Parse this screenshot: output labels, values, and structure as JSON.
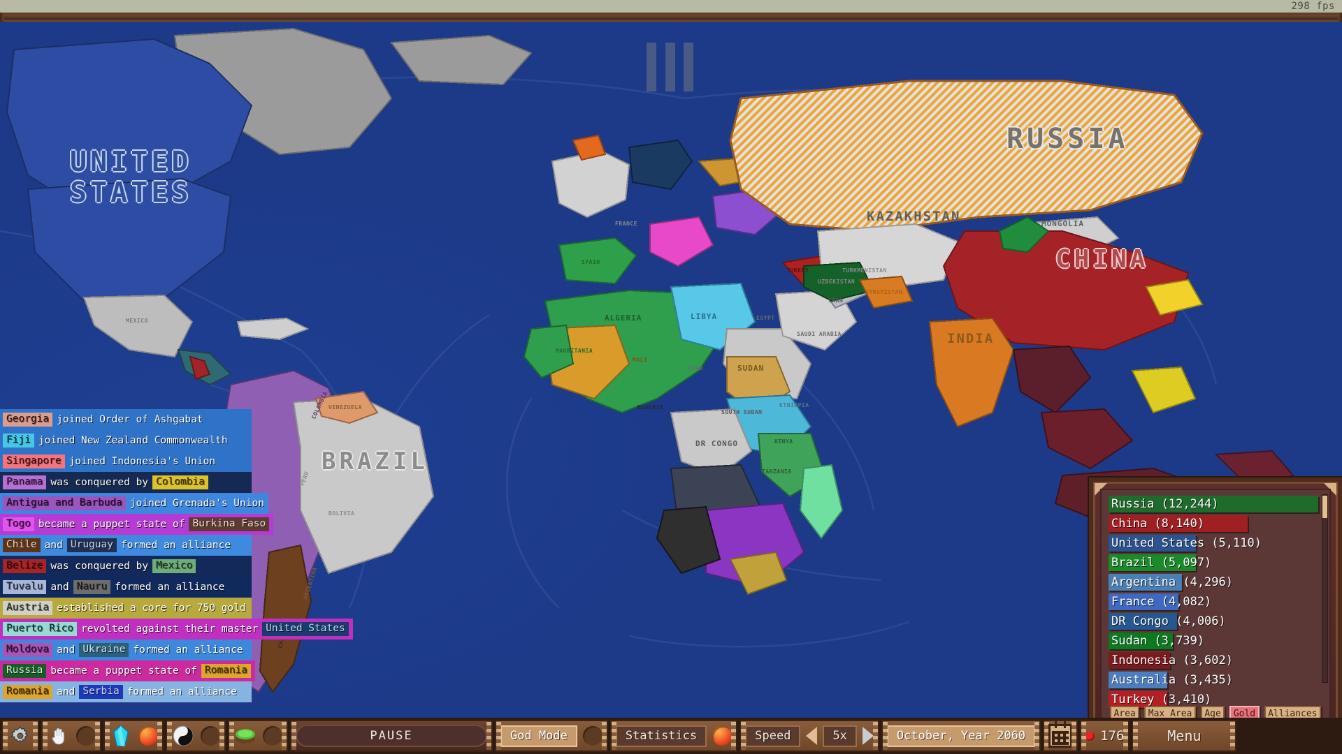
{
  "window": {
    "fps_label": "298 fps"
  },
  "map": {
    "labels": [
      {
        "text": "UNITED STATES",
        "line2": "STATES",
        "line1": "UNITED"
      },
      {
        "text": "RUSSIA"
      },
      {
        "text": "CHINA"
      },
      {
        "text": "BRAZIL"
      },
      {
        "text": "KAZAKHSTAN"
      },
      {
        "text": "MONGOLIA"
      },
      {
        "text": "INDIA"
      },
      {
        "text": "ALGERIA"
      },
      {
        "text": "LIBYA"
      },
      {
        "text": "EGYPT"
      },
      {
        "text": "SUDAN"
      },
      {
        "text": "CHAD"
      },
      {
        "text": "MALI"
      },
      {
        "text": "MAURITANIA"
      },
      {
        "text": "NIGERIA"
      },
      {
        "text": "DR CONGO"
      },
      {
        "text": "KENYA"
      },
      {
        "text": "TANZANIA"
      },
      {
        "text": "ETHIOPIA"
      },
      {
        "text": "SOUTH SUDAN"
      },
      {
        "text": "SAUDI ARABIA"
      },
      {
        "text": "IRAN"
      },
      {
        "text": "TURKEY"
      },
      {
        "text": "UZBEKISTAN"
      },
      {
        "text": "TURKMENISTAN"
      },
      {
        "text": "KYRGYZSTAN"
      },
      {
        "text": "FRANCE"
      },
      {
        "text": "SPAIN"
      },
      {
        "text": "MEXICO"
      },
      {
        "text": "COLOMBIA"
      },
      {
        "text": "VENEZUELA"
      },
      {
        "text": "PERU"
      },
      {
        "text": "BOLIVIA"
      },
      {
        "text": "ARGENTINA"
      },
      {
        "text": "CHILE"
      }
    ]
  },
  "event_log": {
    "rows": [
      {
        "bg": "#2f73c9",
        "parts": [
          {
            "text": "Georgia",
            "tag": true,
            "bg": "#dd9c8e",
            "color": "#241414"
          },
          {
            "text": "joined Order of Ashgabat",
            "tag": false
          }
        ]
      },
      {
        "bg": "#2f73c9",
        "parts": [
          {
            "text": "Fiji",
            "tag": true,
            "bg": "#45c8e8",
            "color": "#12303a"
          },
          {
            "text": "joined New Zealand Commonwealth",
            "tag": false
          }
        ]
      },
      {
        "bg": "#2f73c9",
        "parts": [
          {
            "text": "Singapore",
            "tag": true,
            "bg": "#f4757e",
            "color": "#3a0e12"
          },
          {
            "text": "joined Indonesia's Union",
            "tag": false
          }
        ]
      },
      {
        "bg": "#152a52",
        "parts": [
          {
            "text": "Panama",
            "tag": true,
            "bg": "#b86fd4",
            "color": "#2b1036"
          },
          {
            "text": "was conquered by",
            "tag": false
          },
          {
            "text": "Colombia",
            "tag": true,
            "bg": "#ddc229",
            "color": "#3a3105"
          }
        ]
      },
      {
        "bg": "#3f86de",
        "parts": [
          {
            "text": "Antigua and Barbuda",
            "tag": true,
            "bg": "#9b55bd",
            "color": "#1e0b28"
          },
          {
            "text": "joined Grenada's Union",
            "tag": false
          }
        ]
      },
      {
        "bg": "#b63ad4",
        "parts": [
          {
            "text": "Togo",
            "tag": true,
            "bg": "#e254ee",
            "color": "#340a38"
          },
          {
            "text": "became a puppet state of",
            "tag": false
          },
          {
            "text": "Burkina Faso",
            "tag": true,
            "bg": "#5d3a32",
            "color": "#f0dfd5"
          }
        ]
      },
      {
        "bg": "#3d8ade",
        "parts": [
          {
            "text": "Chile",
            "tag": true,
            "bg": "#5e3318",
            "color": "#f2e0cd"
          },
          {
            "text": "and",
            "tag": false
          },
          {
            "text": "Uruguay",
            "tag": true,
            "bg": "#1f3054",
            "color": "#ccd6e8"
          },
          {
            "text": "formed an alliance",
            "tag": false
          }
        ]
      },
      {
        "bg": "#12295a",
        "parts": [
          {
            "text": "Belize",
            "tag": true,
            "bg": "#a82426",
            "color": "#2c0607"
          },
          {
            "text": "was conquered by",
            "tag": false
          },
          {
            "text": "Mexico",
            "tag": true,
            "bg": "#6fad78",
            "color": "#16301a"
          }
        ]
      },
      {
        "bg": "#102a5e",
        "parts": [
          {
            "text": "Tuvalu",
            "tag": true,
            "bg": "#a8b6d8",
            "color": "#1c2434"
          },
          {
            "text": "and",
            "tag": false
          },
          {
            "text": "Nauru",
            "tag": true,
            "bg": "#6d6d6d",
            "color": "#18181a"
          },
          {
            "text": "formed an alliance",
            "tag": false
          }
        ]
      },
      {
        "bg": "#b8a93c",
        "parts": [
          {
            "text": "Austria",
            "tag": true,
            "bg": "#d0d0c8",
            "color": "#24241e"
          },
          {
            "text": "established a core for 750 gold",
            "tag": false
          }
        ]
      },
      {
        "bg": "#c12fc0",
        "parts": [
          {
            "text": "Puerto Rico",
            "tag": true,
            "bg": "#97d9d4",
            "color": "#10302e"
          },
          {
            "text": "revolted against their master",
            "tag": false
          },
          {
            "text": "United States",
            "tag": true,
            "bg": "#1b3a6e",
            "color": "#c8d6ec"
          }
        ]
      },
      {
        "bg": "#3c88dc",
        "parts": [
          {
            "text": "Moldova",
            "tag": true,
            "bg": "#a855b6",
            "color": "#2a0d2e"
          },
          {
            "text": "and",
            "tag": false
          },
          {
            "text": "Ukraine",
            "tag": true,
            "bg": "#2c5f7a",
            "color": "#d0e2ec"
          },
          {
            "text": "formed an alliance",
            "tag": false
          }
        ]
      },
      {
        "bg": "#cc2a9e",
        "parts": [
          {
            "text": "Russia",
            "tag": true,
            "bg": "#1a5c28",
            "color": "#d8eedd"
          },
          {
            "text": "became a puppet state of",
            "tag": false
          },
          {
            "text": "Romania",
            "tag": true,
            "bg": "#dea52c",
            "color": "#3a2706"
          }
        ]
      },
      {
        "bg": "#86b4e2",
        "parts": [
          {
            "text": "Romania",
            "tag": true,
            "bg": "#dea52c",
            "color": "#3a2706"
          },
          {
            "text": "and",
            "tag": false
          },
          {
            "text": "Serbia",
            "tag": true,
            "bg": "#1c39b8",
            "color": "#cfd8f4"
          },
          {
            "text": "formed an alliance"
          }
        ]
      }
    ]
  },
  "leaderboard": {
    "metric": "Gold",
    "max_value": 12244,
    "entries": [
      {
        "name": "Russia",
        "value": 12244,
        "display": "Russia (12,244)",
        "color": "#1f6b2b"
      },
      {
        "name": "China",
        "value": 8140,
        "display": "China (8,140)",
        "color": "#a01f22"
      },
      {
        "name": "United States",
        "value": 5110,
        "display": "United States (5,110)",
        "color": "#2b5390"
      },
      {
        "name": "Brazil",
        "value": 5097,
        "display": "Brazil (5,097)",
        "color": "#1a8a2a"
      },
      {
        "name": "Argentina",
        "value": 4296,
        "display": "Argentina (4,296)",
        "color": "#4a7fb5"
      },
      {
        "name": "France",
        "value": 4082,
        "display": "France (4,082)",
        "color": "#3f68c0"
      },
      {
        "name": "DR Congo",
        "value": 4006,
        "display": "DR Congo (4,006)",
        "color": "#26578f"
      },
      {
        "name": "Sudan",
        "value": 3739,
        "display": "Sudan (3,739)",
        "color": "#0d7a22"
      },
      {
        "name": "Indonesia",
        "value": 3602,
        "display": "Indonesia (3,602)",
        "color": "#7a1b1e"
      },
      {
        "name": "Australia",
        "value": 3435,
        "display": "Australia (3,435)",
        "color": "#4a7ec2"
      },
      {
        "name": "Turkey",
        "value": 3410,
        "display": "Turkey (3,410)",
        "color": "#b22026"
      }
    ],
    "tabs": [
      {
        "label": "Area",
        "active": false
      },
      {
        "label": "Max Area",
        "active": false
      },
      {
        "label": "Age",
        "active": false
      },
      {
        "label": "Gold",
        "active": true
      },
      {
        "label": "Alliances",
        "active": false
      }
    ]
  },
  "toolbar": {
    "gear_icon": "gear-icon",
    "tool_slots": [
      {
        "icon": "hand-icon",
        "glyph": "✋"
      },
      {
        "icon": "crystal-icon",
        "glyph": "◆"
      },
      {
        "icon": "yinyang-icon",
        "glyph": "☯"
      },
      {
        "icon": "terrain-icon",
        "glyph": "▰"
      }
    ],
    "pause_label": "PAUSE",
    "god_mode_label": "God Mode",
    "statistics_label": "Statistics",
    "speed_label": "Speed",
    "speed_value": "5x",
    "date_label": "October, Year 2060",
    "calendar_icon": "calendar-icon",
    "counter_value": "176",
    "menu_label": "Menu"
  }
}
